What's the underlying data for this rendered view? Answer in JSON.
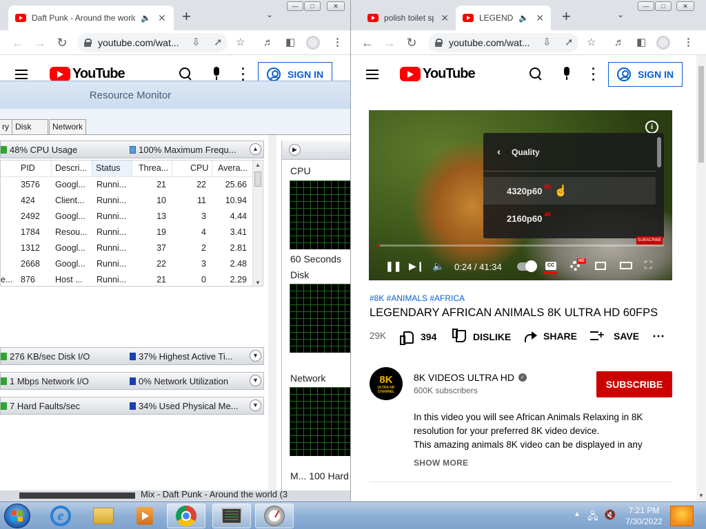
{
  "left_browser": {
    "tab_title": "Daft Punk - Around the world",
    "url": "youtube.com/wat...",
    "yt_logo_text": "YouTube",
    "sign_in": "SIGN IN"
  },
  "resource_monitor": {
    "title": "Resource Monitor",
    "tabs": [
      "ry",
      "Disk",
      "Network"
    ],
    "cpu_usage": "48% CPU Usage",
    "max_freq": "100% Maximum Frequ...",
    "columns": [
      "PID",
      "Descri...",
      "Status",
      "Threa...",
      "CPU",
      "Avera..."
    ],
    "rows": [
      {
        "pid": "3576",
        "desc": "Googl...",
        "status": "Runni...",
        "threads": "21",
        "cpu": "22",
        "avg": "25.66",
        "pre": ""
      },
      {
        "pid": "424",
        "desc": "Client...",
        "status": "Runni...",
        "threads": "10",
        "cpu": "11",
        "avg": "10.94",
        "pre": ""
      },
      {
        "pid": "2492",
        "desc": "Googl...",
        "status": "Runni...",
        "threads": "13",
        "cpu": "3",
        "avg": "4.44",
        "pre": ""
      },
      {
        "pid": "1784",
        "desc": "Resou...",
        "status": "Runni...",
        "threads": "19",
        "cpu": "4",
        "avg": "3.41",
        "pre": ""
      },
      {
        "pid": "1312",
        "desc": "Googl...",
        "status": "Runni...",
        "threads": "37",
        "cpu": "2",
        "avg": "2.81",
        "pre": ""
      },
      {
        "pid": "2668",
        "desc": "Googl...",
        "status": "Runni...",
        "threads": "22",
        "cpu": "3",
        "avg": "2.48",
        "pre": ""
      },
      {
        "pid": "876",
        "desc": "Host ...",
        "status": "Runni...",
        "threads": "21",
        "cpu": "0",
        "avg": "2.29",
        "pre": "e..."
      }
    ],
    "disk_io": "276 KB/sec Disk I/O",
    "disk_active": "37% Highest Active Ti...",
    "net_io": "1 Mbps Network I/O",
    "net_util": "0% Network Utilization",
    "faults": "7 Hard Faults/sec",
    "phys_mem": "34% Used Physical Me...",
    "graph_cpu": "CPU",
    "graph_60": "60 Seconds",
    "graph_disk": "Disk",
    "graph_network": "Network",
    "graph_bottom": "M...  100 Hard"
  },
  "right_browser": {
    "tab1_title": "polish toilet sp",
    "tab2_title": "LEGENDA",
    "url": "youtube.com/wat...",
    "yt_logo_text": "YouTube",
    "sign_in": "SIGN IN"
  },
  "video": {
    "quality_label": "Quality",
    "q1": "4320p60",
    "q1_badge": "8K",
    "q2": "2160p60",
    "q2_badge": "4K",
    "time": "0:24 / 41:34",
    "hd_badge": "HD",
    "cc": "CC",
    "watermark": "SUBSCRIBE",
    "progress_fraction": 0.0096
  },
  "watch": {
    "tags": "#8K #ANIMALS #AFRICA",
    "title": "LEGENDARY AFRICAN ANIMALS 8K ULTRA HD 60FPS",
    "views": "29K",
    "likes": "394",
    "dislike": "DISLIKE",
    "share": "SHARE",
    "save": "SAVE",
    "channel": "8K VIDEOS ULTRA HD",
    "avatar_big": "8K",
    "avatar_small": "ULTRA HD",
    "avatar_small2": "CHANNEL",
    "subscribers": "600K subscribers",
    "subscribe": "SUBSCRIBE",
    "desc1": "In this video you will see African Animals Relaxing in 8K resolution for your preferred 8K video device.",
    "desc2": "This amazing animals 8K video can be displayed in any",
    "show_more": "SHOW MORE"
  },
  "taskbar": {
    "strip_label": "Mix - Daft Punk - Around the world (3",
    "time": "7:21 PM",
    "date": "7/30/2022"
  },
  "colors": {
    "yt_red": "#ff0000",
    "subscribe_red": "#cc0000",
    "link_blue": "#065fd4",
    "graph_green": "#1e6b1e"
  }
}
